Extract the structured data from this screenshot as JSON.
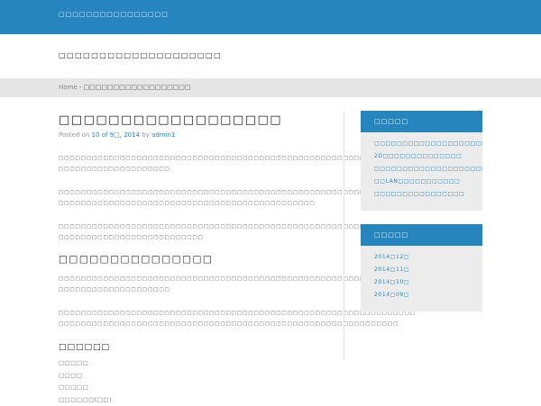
{
  "topbar": {
    "site_name": "□□□□□□□□□□□□□□□□"
  },
  "header": {
    "title": "□□□□□□□□□□□□□□□□□□□□"
  },
  "breadcrumb": {
    "home": "Home",
    "separator": "›",
    "current": "□□□□□□□□□□□□□□□□□□"
  },
  "post": {
    "title": "□□□□□□□□□□□□□□□□□□",
    "meta_prefix": "Posted on",
    "date": "10 of 9□, 2014",
    "by": "by",
    "author": "admin1",
    "para1_l1": "□□□□□□□□□□□□□□□□□□□□□□□□□□□□□□□□□□□□□□□□□□□□□□□□□□□□□□□□□□□□□□□□",
    "para1_l2": "□□□□□□□□□□□□□□□□□□□□",
    "para2_l1": "□□□□□□□□□□□□□□□□□□□□□□□□□□□□□□□□□□□□□□□□□□□□□□□□□□□□□□□□□□□□□□□□",
    "para2_l2": "□□□□□□□□□□□□□□□□□□□□□□□□□□□□□□□□□□□□□□□□□□□□□□",
    "para3_l1": "□□□□□□□□□□□□□□□□□□□□□□□□□□□□□□□□□□□□□□□□□□□□□□□□□□□□□□□□□□□□□□□□",
    "para3_l2": "□□□□□□□□□□□□□□□□□□□□□□□□□□",
    "h2": "□□□□□□□□□□□□□□□",
    "para4_l1": "□□□□□□□□□□□□□□□□□□□□□□□□□□□□□□□□□□□□□□□□□□□□□□□□□□□□□□□□□□□□□□□□",
    "para4_l2": "□□□□□□□□□□□□□□□□□□□□",
    "para5_l1": "□□□□□□□□□□□□□□□□□□□□□□□□□□□□□□□□□□□□□□□□□□□□□□□□□□□□□□□□□□□□□□□□",
    "para5_l2": "□□□□□□□□□□□□□□□□□□□□□□□□□□□□□□□□□□□□□□□□□□□□□□□□□□□□□□□□□□□□□",
    "h3": "□□□□□□",
    "list": [
      "□□□□□",
      "□□□□",
      "□□□□□",
      "□□□□□□(□□)"
    ]
  },
  "sidebar": {
    "recent_title": "□□□□□",
    "recent_posts": [
      "□□□□□□□□□□□□□□□□□□□□□",
      "2D□□□□□□□□□□□□□□",
      "□□□□□□□□□□□□□□□□□□□□□□□□□□□",
      "□□LAN□□□□□□□□□□□",
      "□□□□□□□□□□□□□□□□"
    ],
    "archive_title": "□□□□□",
    "archives": [
      "2014□12□",
      "2014□11□",
      "2014□10□",
      "2014□09□"
    ]
  },
  "colors": {
    "accent": "#2685bd",
    "breadcrumb_bg": "#e6e6e6",
    "widget_bg": "#ececec"
  }
}
